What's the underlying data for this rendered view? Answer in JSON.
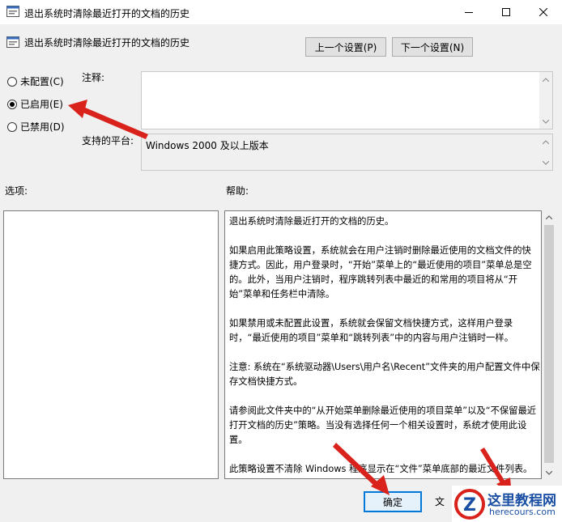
{
  "window": {
    "title": "退出系统时清除最近打开的文档的历史"
  },
  "header": {
    "policy_title": "退出系统时清除最近打开的文档的历史",
    "prev_button": "上一个设置(P)",
    "next_button": "下一个设置(N)"
  },
  "radios": [
    {
      "label": "未配置(C)",
      "selected": false
    },
    {
      "label": "已启用(E)",
      "selected": true
    },
    {
      "label": "已禁用(D)",
      "selected": false
    }
  ],
  "fields": {
    "comment_label": "注释:",
    "comment_value": "",
    "platform_label": "支持的平台:",
    "platform_value": "Windows 2000 及以上版本"
  },
  "sections": {
    "options_label": "选项:",
    "help_label": "帮助:"
  },
  "help": {
    "paragraphs": [
      "退出系统时清除最近打开的文档的历史。",
      "如果启用此策略设置，系统就会在用户注销时删除最近使用的文档文件的快捷方式。因此，用户登录时，“开始”菜单上的“最近使用的项目”菜单总是空的。此外，当用户注销时，程序跳转列表中最近的和常用的项目将从“开始”菜单和任务栏中清除。",
      "如果禁用或未配置此设置，系统就会保留文档快捷方式，这样用户登录时，“最近使用的项目”菜单和“跳转列表”中的内容与用户注销时一样。",
      "注意: 系统在“系统驱动器\\Users\\用户名\\Recent”文件夹的用户配置文件中保存文档快捷方式。",
      "请参阅此文件夹中的“从开始菜单删除最近使用的项目菜单”以及“不保留最近打开文档的历史”策略。当没有选择任何一个相关设置时，系统才使用此设置。",
      "此策略设置不清除 Windows 程序显示在“文件”菜单底部的最近文件列表。请参阅“不保留最近打开文档的历史”策略设置。"
    ]
  },
  "footer": {
    "ok_button": "确定",
    "partial_text": "文"
  },
  "watermark": {
    "name": "这里教程网",
    "url": "herecours.com"
  },
  "colors": {
    "annotation_arrow": "#d9221c",
    "watermark_blue": "#1a4fa3"
  }
}
